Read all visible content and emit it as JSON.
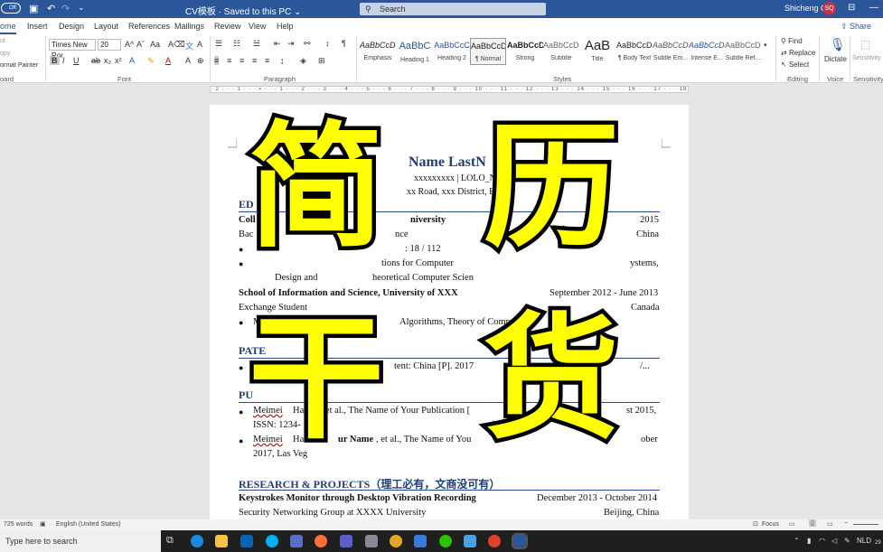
{
  "titlebar": {
    "autosave": "Off",
    "doc_title": "CV模板 · Saved to this PC ⌄",
    "search_placeholder": "Search",
    "user_name": "Shicheng Qi",
    "user_initials": "SQ"
  },
  "tabs": [
    "ome",
    "Insert",
    "Design",
    "Layout",
    "References",
    "Mailings",
    "Review",
    "View",
    "Help"
  ],
  "share_label": "Share",
  "ribbon": {
    "clipboard": {
      "cut": "ut",
      "copy": "opy",
      "format_painter": "ormat Painter",
      "group": "oard"
    },
    "font": {
      "name": "Times New Ror",
      "size": "20",
      "group": "Font"
    },
    "paragraph": {
      "group": "Paragraph"
    },
    "styles": {
      "group": "Styles",
      "items": [
        {
          "preview": "AaBbCcDd",
          "name": "Emphasis"
        },
        {
          "preview": "AaBbC",
          "name": "Heading 1"
        },
        {
          "preview": "AaBbCcC",
          "name": "Heading 2"
        },
        {
          "preview": "AaBbCcDd",
          "name": "¶ Normal"
        },
        {
          "preview": "AaBbCcDd",
          "name": "Strong"
        },
        {
          "preview": "AaBbCcDc",
          "name": "Subtitle"
        },
        {
          "preview": "AaB",
          "name": "Title"
        },
        {
          "preview": "AaBbCcDc",
          "name": "¶ Body Text"
        },
        {
          "preview": "AaBbCcDd",
          "name": "Subtle Em..."
        },
        {
          "preview": "AaBbCcDd",
          "name": "Intense E..."
        },
        {
          "preview": "AaBbCcDd",
          "name": "Subtle Ref..."
        }
      ]
    },
    "editing": {
      "find": "Find",
      "replace": "Replace",
      "select": "Select",
      "group": "Editing"
    },
    "voice": {
      "dictate": "Dictate",
      "group": "Voice"
    },
    "sensitivity": {
      "label": "Sensitivity",
      "group": "Sensitivity"
    }
  },
  "ruler_text": "· 2 · · · 1 · · · ▪ · · · 1 · · · 2 · · · 3 · · · 4 · · · 5 · · · 6 · · · 7 · · · 8 · · · 9 · · · 10 · · · 11 · · · 12 · · · 13 · · · 14 · · · 15 · · · 16 · · · 17 · · · 18 · · · 19",
  "document": {
    "name_line": "Name LastN",
    "contact_line": "xxxxxxxxx | LOLO_NL@",
    "address_line": "xx Road, xxx District, Bei",
    "education_head": "ED",
    "edu_school": "Coll",
    "edu_univ": "niversity",
    "edu_year": "2015",
    "edu_degree": "Bac",
    "edu_field": "nce",
    "edu_loc": "China",
    "edu_rank": ": 18 / 112",
    "edu_courses": "tions  for  Computer",
    "edu_courses_r": "ystems,",
    "edu_courses2a": "Design and",
    "edu_courses2b": "heoretical Computer Scien",
    "exch_school": "School of Information and Science, University of XXX",
    "exch_date": "September 2012 - June 2013",
    "exch_role": "Exchange Student",
    "exch_loc": "Canada",
    "exch_courses_a": "M",
    "exch_courses_b": "Algorithms, Theory of Comp",
    "patent_head": "PATE",
    "patent_item": "tent: China [P]. 2017",
    "patent_tail": "/...",
    "pub_head": "PU",
    "pub1_a": "Meimei",
    "pub1_b": "Han",
    "pub1_c": "e, et al., The Name of Your Publication [",
    "pub1_d": "st 2015,",
    "pub1_issn": "ISSN: 1234-",
    "pub2_a": "Meimei",
    "pub2_b": "Han",
    "pub2_c": "ur Name",
    "pub2_d": ", et al., The Name of You",
    "pub2_e": "ober",
    "pub2_loc": "2017, Las Veg",
    "research_head": "RESEARCH & PROJECTS（理工必有，文商没可有）",
    "proj_title": "Keystrokes Monitor through Desktop Vibration Recording",
    "proj_date": "December 2013 - October 2014",
    "proj_group": "Security Networking Group at XXXX University",
    "proj_loc": "Beijing, China"
  },
  "overlay": [
    "简",
    "历",
    "干",
    "货"
  ],
  "status": {
    "words": "725 words",
    "language": "English (United States)",
    "focus": "Focus"
  },
  "taskbar": {
    "search": "Type here to search",
    "lang": "NLD",
    "time": "29"
  },
  "colors": {
    "word_blue": "#2b579a",
    "overlay_yellow": "#ffff00",
    "heading_blue": "#1f3f7a"
  }
}
